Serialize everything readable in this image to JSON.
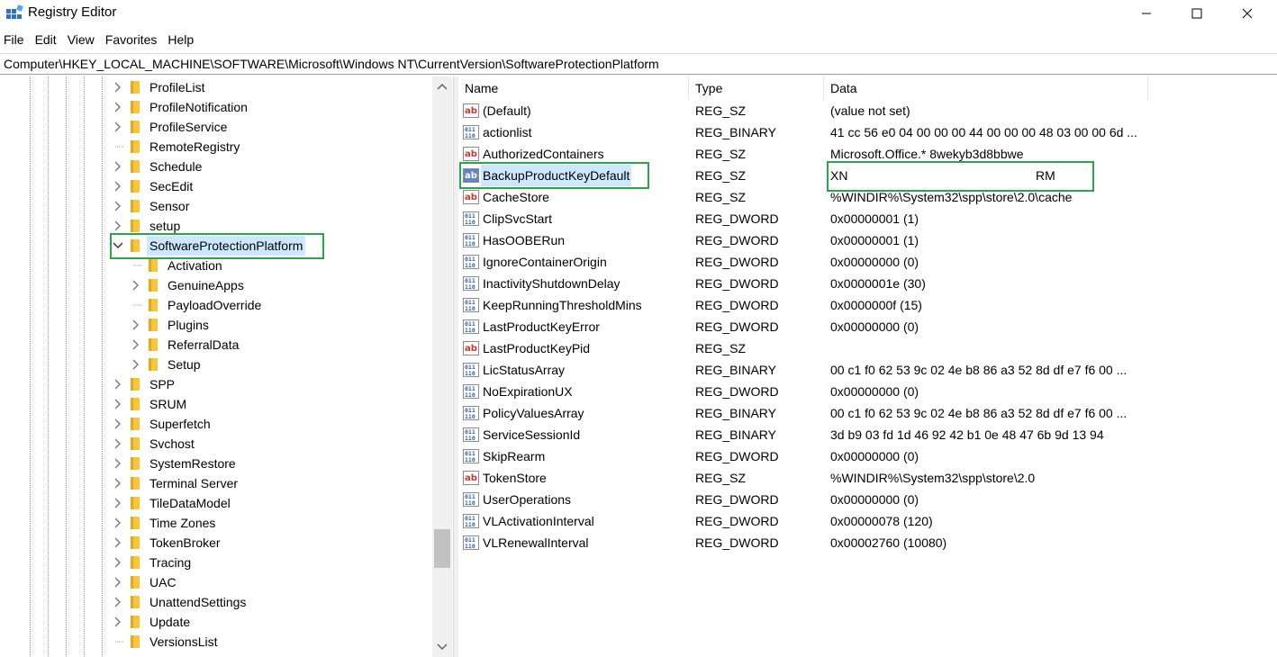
{
  "window": {
    "title": "Registry Editor",
    "icon": "regedit-icon"
  },
  "menu": [
    "File",
    "Edit",
    "View",
    "Favorites",
    "Help"
  ],
  "address": "Computer\\HKEY_LOCAL_MACHINE\\SOFTWARE\\Microsoft\\Windows NT\\CurrentVersion\\SoftwareProtectionPlatform",
  "tree": {
    "items": [
      {
        "label": "ProfileList",
        "level": 0,
        "expand": "collapsed"
      },
      {
        "label": "ProfileNotification",
        "level": 0,
        "expand": "collapsed"
      },
      {
        "label": "ProfileService",
        "level": 0,
        "expand": "collapsed"
      },
      {
        "label": "RemoteRegistry",
        "level": 0,
        "expand": "none"
      },
      {
        "label": "Schedule",
        "level": 0,
        "expand": "collapsed"
      },
      {
        "label": "SecEdit",
        "level": 0,
        "expand": "collapsed"
      },
      {
        "label": "Sensor",
        "level": 0,
        "expand": "collapsed"
      },
      {
        "label": "setup",
        "level": 0,
        "expand": "collapsed"
      },
      {
        "label": "SoftwareProtectionPlatform",
        "level": 0,
        "expand": "expanded",
        "selected": true
      },
      {
        "label": "Activation",
        "level": 1,
        "expand": "none"
      },
      {
        "label": "GenuineApps",
        "level": 1,
        "expand": "collapsed"
      },
      {
        "label": "PayloadOverride",
        "level": 1,
        "expand": "none"
      },
      {
        "label": "Plugins",
        "level": 1,
        "expand": "collapsed"
      },
      {
        "label": "ReferralData",
        "level": 1,
        "expand": "collapsed"
      },
      {
        "label": "Setup",
        "level": 1,
        "expand": "collapsed"
      },
      {
        "label": "SPP",
        "level": 0,
        "expand": "collapsed"
      },
      {
        "label": "SRUM",
        "level": 0,
        "expand": "collapsed"
      },
      {
        "label": "Superfetch",
        "level": 0,
        "expand": "collapsed"
      },
      {
        "label": "Svchost",
        "level": 0,
        "expand": "collapsed"
      },
      {
        "label": "SystemRestore",
        "level": 0,
        "expand": "collapsed"
      },
      {
        "label": "Terminal Server",
        "level": 0,
        "expand": "collapsed"
      },
      {
        "label": "TileDataModel",
        "level": 0,
        "expand": "collapsed"
      },
      {
        "label": "Time Zones",
        "level": 0,
        "expand": "collapsed"
      },
      {
        "label": "TokenBroker",
        "level": 0,
        "expand": "collapsed"
      },
      {
        "label": "Tracing",
        "level": 0,
        "expand": "collapsed"
      },
      {
        "label": "UAC",
        "level": 0,
        "expand": "collapsed"
      },
      {
        "label": "UnattendSettings",
        "level": 0,
        "expand": "collapsed"
      },
      {
        "label": "Update",
        "level": 0,
        "expand": "collapsed"
      },
      {
        "label": "VersionsList",
        "level": 0,
        "expand": "none"
      }
    ]
  },
  "list": {
    "columns": [
      "Name",
      "Type",
      "Data"
    ],
    "rows": [
      {
        "name": "(Default)",
        "type": "REG_SZ",
        "data": "(value not set)",
        "icon": "string-value-icon"
      },
      {
        "name": "actionlist",
        "type": "REG_BINARY",
        "data": "41 cc 56 e0 04 00 00 00 44 00 00 00 48 03 00 00 6d ...",
        "icon": "binary-value-icon"
      },
      {
        "name": "AuthorizedContainers",
        "type": "REG_SZ",
        "data": "Microsoft.Office.* 8wekyb3d8bbwe",
        "icon": "string-value-icon"
      },
      {
        "name": "BackupProductKeyDefault",
        "type": "REG_SZ",
        "data": "XN",
        "data_end": "RM",
        "icon": "string-value-icon",
        "selected": true
      },
      {
        "name": "CacheStore",
        "type": "REG_SZ",
        "data": "%WINDIR%\\System32\\spp\\store\\2.0\\cache",
        "icon": "string-value-icon"
      },
      {
        "name": "ClipSvcStart",
        "type": "REG_DWORD",
        "data": "0x00000001 (1)",
        "icon": "binary-value-icon"
      },
      {
        "name": "HasOOBERun",
        "type": "REG_DWORD",
        "data": "0x00000001 (1)",
        "icon": "binary-value-icon"
      },
      {
        "name": "IgnoreContainerOrigin",
        "type": "REG_DWORD",
        "data": "0x00000000 (0)",
        "icon": "binary-value-icon"
      },
      {
        "name": "InactivityShutdownDelay",
        "type": "REG_DWORD",
        "data": "0x0000001e (30)",
        "icon": "binary-value-icon"
      },
      {
        "name": "KeepRunningThresholdMins",
        "type": "REG_DWORD",
        "data": "0x0000000f (15)",
        "icon": "binary-value-icon"
      },
      {
        "name": "LastProductKeyError",
        "type": "REG_DWORD",
        "data": "0x00000000 (0)",
        "icon": "binary-value-icon"
      },
      {
        "name": "LastProductKeyPid",
        "type": "REG_SZ",
        "data": "",
        "icon": "string-value-icon"
      },
      {
        "name": "LicStatusArray",
        "type": "REG_BINARY",
        "data": "00 c1 f0 62 53 9c 02 4e b8 86 a3 52 8d df e7 f6 00 ...",
        "icon": "binary-value-icon"
      },
      {
        "name": "NoExpirationUX",
        "type": "REG_DWORD",
        "data": "0x00000000 (0)",
        "icon": "binary-value-icon"
      },
      {
        "name": "PolicyValuesArray",
        "type": "REG_BINARY",
        "data": "00 c1 f0 62 53 9c 02 4e b8 86 a3 52 8d df e7 f6 00 ...",
        "icon": "binary-value-icon"
      },
      {
        "name": "ServiceSessionId",
        "type": "REG_BINARY",
        "data": "3d b9 03 fd 1d 46 92 42 b1 0e 48 47 6b 9d 13 94",
        "icon": "binary-value-icon"
      },
      {
        "name": "SkipRearm",
        "type": "REG_DWORD",
        "data": "0x00000000 (0)",
        "icon": "binary-value-icon"
      },
      {
        "name": "TokenStore",
        "type": "REG_SZ",
        "data": "%WINDIR%\\System32\\spp\\store\\2.0",
        "icon": "string-value-icon"
      },
      {
        "name": "UserOperations",
        "type": "REG_DWORD",
        "data": "0x00000000 (0)",
        "icon": "binary-value-icon"
      },
      {
        "name": "VLActivationInterval",
        "type": "REG_DWORD",
        "data": "0x00000078 (120)",
        "icon": "binary-value-icon"
      },
      {
        "name": "VLRenewalInterval",
        "type": "REG_DWORD",
        "data": "0x00002760 (10080)",
        "icon": "binary-value-icon"
      }
    ]
  },
  "colors": {
    "highlight_box": "#2aa547",
    "selection": "#cce8ff",
    "folder": "#f8c43a",
    "string_icon_red": "#c8372d",
    "binary_icon_blue": "#2a5fa8"
  }
}
